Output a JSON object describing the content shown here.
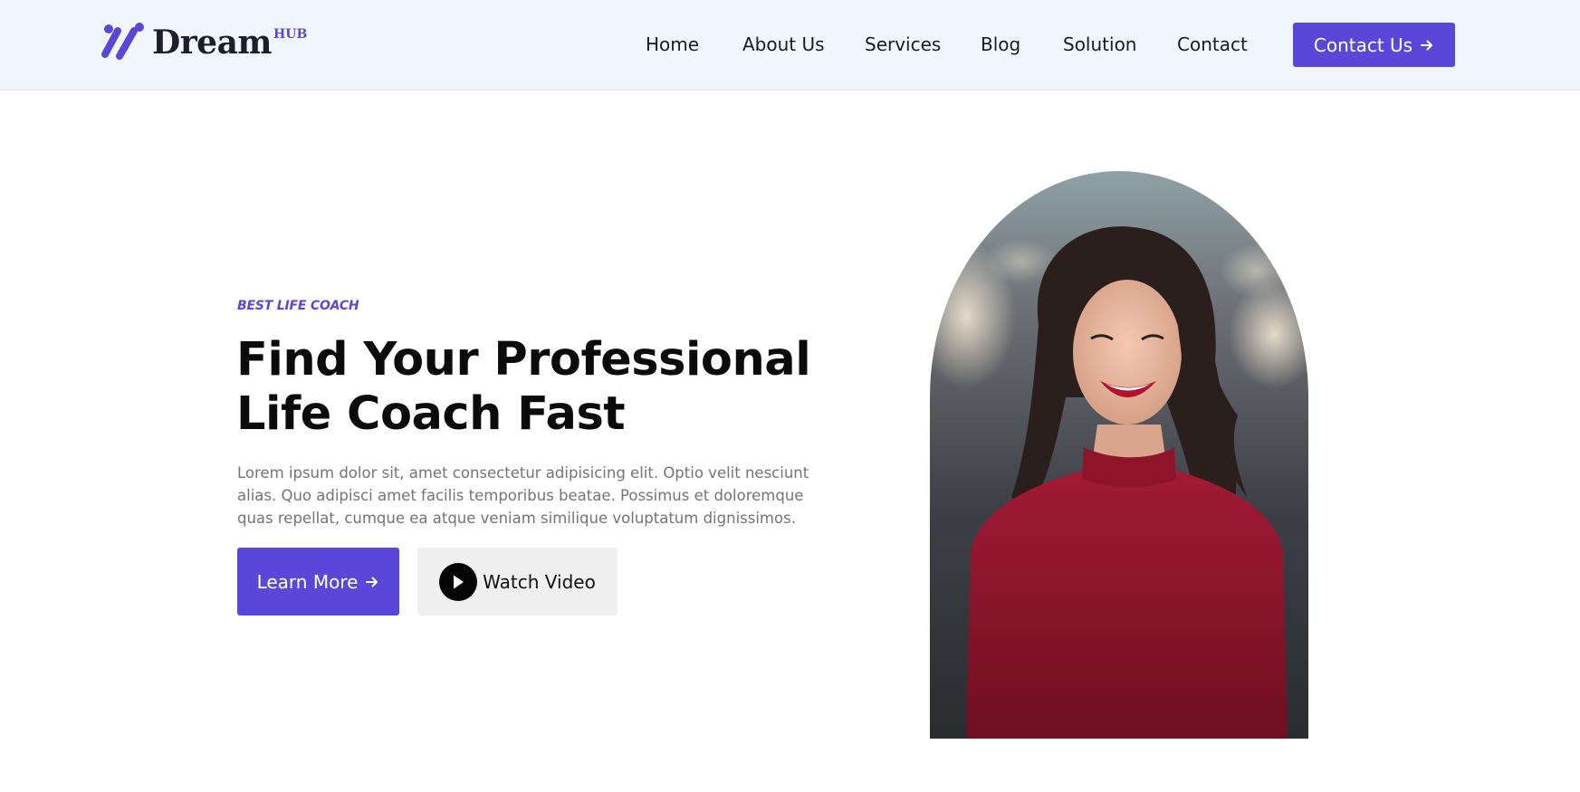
{
  "brand": {
    "name": "Dream",
    "superscript": "HUB",
    "accent_color": "#5a46d9"
  },
  "nav": {
    "items": [
      {
        "label": "Home"
      },
      {
        "label": "About Us"
      },
      {
        "label": "Services"
      },
      {
        "label": "Blog"
      },
      {
        "label": "Solution"
      },
      {
        "label": "Contact"
      }
    ],
    "cta_label": "Contact Us",
    "cta_icon": "arrow-right-icon"
  },
  "hero": {
    "eyebrow": "BEST LIFE COACH",
    "headline_line1": "Find Your Professional",
    "headline_line2": "Life Coach Fast",
    "body": "Lorem ipsum dolor sit, amet consectetur adipisicing elit. Optio velit nesciunt alias. Quo adipisci amet facilis temporibus beatae. Possimus et doloremque quas repellat, cumque ea atque veniam similique voluptatum dignissimos.",
    "primary_button": "Learn More",
    "primary_icon": "arrow-right-icon",
    "secondary_button": "Watch Video",
    "secondary_icon": "play-icon"
  },
  "photo": {
    "subject": "smiling woman in red top"
  }
}
